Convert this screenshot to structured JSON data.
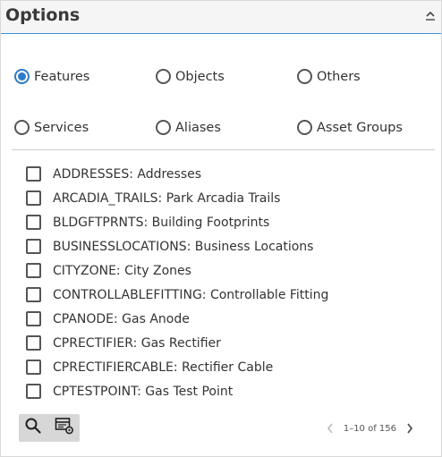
{
  "header": {
    "title": "Options"
  },
  "radios": [
    {
      "label": "Features",
      "checked": true
    },
    {
      "label": "Objects",
      "checked": false
    },
    {
      "label": "Others",
      "checked": false
    },
    {
      "label": "Services",
      "checked": false
    },
    {
      "label": "Aliases",
      "checked": false
    },
    {
      "label": "Asset Groups",
      "checked": false
    }
  ],
  "items": [
    {
      "label": "ADDRESSES: Addresses"
    },
    {
      "label": "ARCADIA_TRAILS: Park Arcadia Trails"
    },
    {
      "label": "BLDGFTPRNTS: Building Footprints"
    },
    {
      "label": "BUSINESSLOCATIONS: Business Locations"
    },
    {
      "label": "CITYZONE: City Zones"
    },
    {
      "label": "CONTROLLABLEFITTING: Controllable Fitting"
    },
    {
      "label": "CPANODE: Gas Anode"
    },
    {
      "label": "CPRECTIFIER: Gas Rectifier"
    },
    {
      "label": "CPRECTIFIERCABLE: Rectifier Cable"
    },
    {
      "label": "CPTESTPOINT: Gas Test Point"
    }
  ],
  "pager": {
    "count": "1–10 of 156"
  },
  "icons": {
    "collapse": "chevron-up-icon",
    "search": "search-icon",
    "table_settings": "table-settings-icon",
    "prev": "chevron-left-icon",
    "next": "chevron-right-icon"
  },
  "colors": {
    "accent": "#2d7bc8",
    "header_bg": "#f5f5f5",
    "toolbar_bg": "#d7d7d7"
  }
}
